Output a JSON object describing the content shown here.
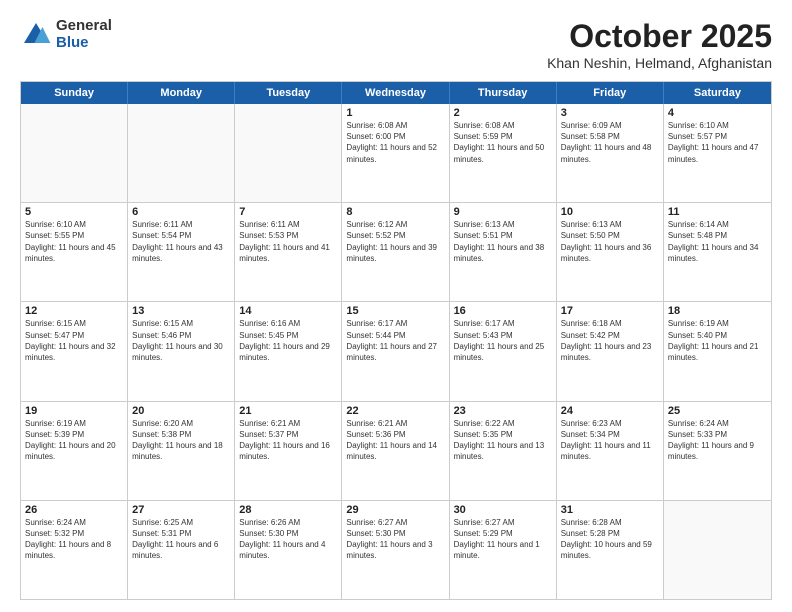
{
  "logo": {
    "general": "General",
    "blue": "Blue"
  },
  "title": "October 2025",
  "location": "Khan Neshin, Helmand, Afghanistan",
  "days_header": [
    "Sunday",
    "Monday",
    "Tuesday",
    "Wednesday",
    "Thursday",
    "Friday",
    "Saturday"
  ],
  "weeks": [
    [
      {
        "day": "",
        "info": ""
      },
      {
        "day": "",
        "info": ""
      },
      {
        "day": "",
        "info": ""
      },
      {
        "day": "1",
        "info": "Sunrise: 6:08 AM\nSunset: 6:00 PM\nDaylight: 11 hours and 52 minutes."
      },
      {
        "day": "2",
        "info": "Sunrise: 6:08 AM\nSunset: 5:59 PM\nDaylight: 11 hours and 50 minutes."
      },
      {
        "day": "3",
        "info": "Sunrise: 6:09 AM\nSunset: 5:58 PM\nDaylight: 11 hours and 48 minutes."
      },
      {
        "day": "4",
        "info": "Sunrise: 6:10 AM\nSunset: 5:57 PM\nDaylight: 11 hours and 47 minutes."
      }
    ],
    [
      {
        "day": "5",
        "info": "Sunrise: 6:10 AM\nSunset: 5:55 PM\nDaylight: 11 hours and 45 minutes."
      },
      {
        "day": "6",
        "info": "Sunrise: 6:11 AM\nSunset: 5:54 PM\nDaylight: 11 hours and 43 minutes."
      },
      {
        "day": "7",
        "info": "Sunrise: 6:11 AM\nSunset: 5:53 PM\nDaylight: 11 hours and 41 minutes."
      },
      {
        "day": "8",
        "info": "Sunrise: 6:12 AM\nSunset: 5:52 PM\nDaylight: 11 hours and 39 minutes."
      },
      {
        "day": "9",
        "info": "Sunrise: 6:13 AM\nSunset: 5:51 PM\nDaylight: 11 hours and 38 minutes."
      },
      {
        "day": "10",
        "info": "Sunrise: 6:13 AM\nSunset: 5:50 PM\nDaylight: 11 hours and 36 minutes."
      },
      {
        "day": "11",
        "info": "Sunrise: 6:14 AM\nSunset: 5:48 PM\nDaylight: 11 hours and 34 minutes."
      }
    ],
    [
      {
        "day": "12",
        "info": "Sunrise: 6:15 AM\nSunset: 5:47 PM\nDaylight: 11 hours and 32 minutes."
      },
      {
        "day": "13",
        "info": "Sunrise: 6:15 AM\nSunset: 5:46 PM\nDaylight: 11 hours and 30 minutes."
      },
      {
        "day": "14",
        "info": "Sunrise: 6:16 AM\nSunset: 5:45 PM\nDaylight: 11 hours and 29 minutes."
      },
      {
        "day": "15",
        "info": "Sunrise: 6:17 AM\nSunset: 5:44 PM\nDaylight: 11 hours and 27 minutes."
      },
      {
        "day": "16",
        "info": "Sunrise: 6:17 AM\nSunset: 5:43 PM\nDaylight: 11 hours and 25 minutes."
      },
      {
        "day": "17",
        "info": "Sunrise: 6:18 AM\nSunset: 5:42 PM\nDaylight: 11 hours and 23 minutes."
      },
      {
        "day": "18",
        "info": "Sunrise: 6:19 AM\nSunset: 5:40 PM\nDaylight: 11 hours and 21 minutes."
      }
    ],
    [
      {
        "day": "19",
        "info": "Sunrise: 6:19 AM\nSunset: 5:39 PM\nDaylight: 11 hours and 20 minutes."
      },
      {
        "day": "20",
        "info": "Sunrise: 6:20 AM\nSunset: 5:38 PM\nDaylight: 11 hours and 18 minutes."
      },
      {
        "day": "21",
        "info": "Sunrise: 6:21 AM\nSunset: 5:37 PM\nDaylight: 11 hours and 16 minutes."
      },
      {
        "day": "22",
        "info": "Sunrise: 6:21 AM\nSunset: 5:36 PM\nDaylight: 11 hours and 14 minutes."
      },
      {
        "day": "23",
        "info": "Sunrise: 6:22 AM\nSunset: 5:35 PM\nDaylight: 11 hours and 13 minutes."
      },
      {
        "day": "24",
        "info": "Sunrise: 6:23 AM\nSunset: 5:34 PM\nDaylight: 11 hours and 11 minutes."
      },
      {
        "day": "25",
        "info": "Sunrise: 6:24 AM\nSunset: 5:33 PM\nDaylight: 11 hours and 9 minutes."
      }
    ],
    [
      {
        "day": "26",
        "info": "Sunrise: 6:24 AM\nSunset: 5:32 PM\nDaylight: 11 hours and 8 minutes."
      },
      {
        "day": "27",
        "info": "Sunrise: 6:25 AM\nSunset: 5:31 PM\nDaylight: 11 hours and 6 minutes."
      },
      {
        "day": "28",
        "info": "Sunrise: 6:26 AM\nSunset: 5:30 PM\nDaylight: 11 hours and 4 minutes."
      },
      {
        "day": "29",
        "info": "Sunrise: 6:27 AM\nSunset: 5:30 PM\nDaylight: 11 hours and 3 minutes."
      },
      {
        "day": "30",
        "info": "Sunrise: 6:27 AM\nSunset: 5:29 PM\nDaylight: 11 hours and 1 minute."
      },
      {
        "day": "31",
        "info": "Sunrise: 6:28 AM\nSunset: 5:28 PM\nDaylight: 10 hours and 59 minutes."
      },
      {
        "day": "",
        "info": ""
      }
    ]
  ]
}
